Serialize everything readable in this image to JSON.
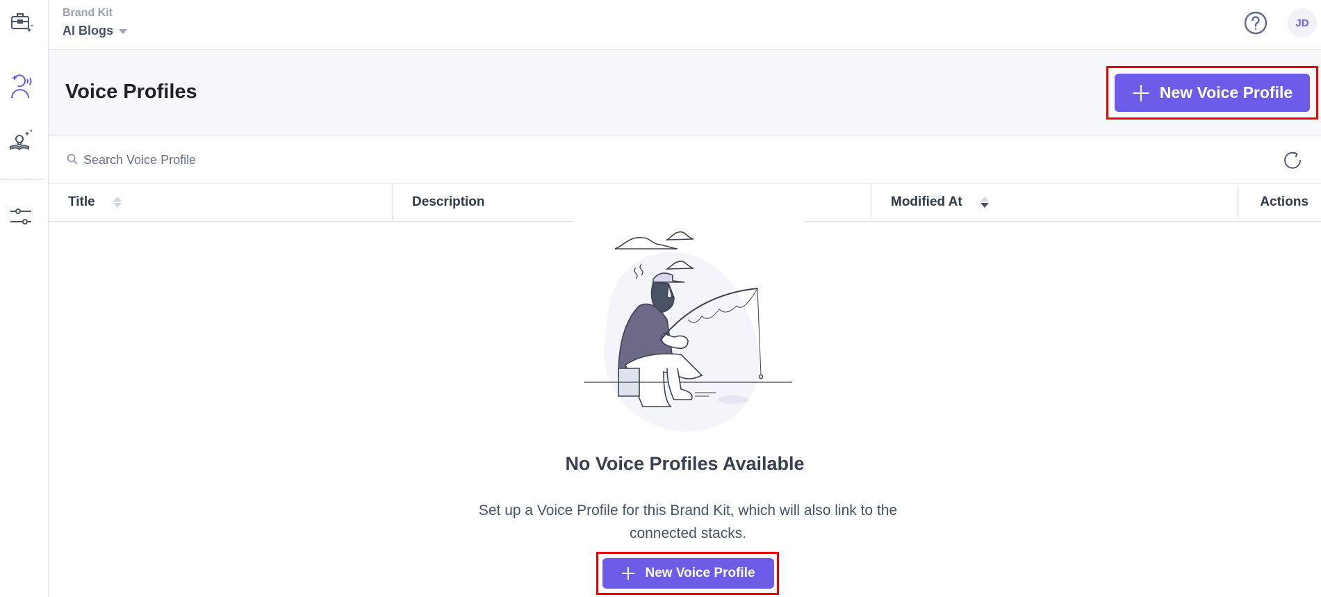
{
  "topbar": {
    "breadcrumb_parent": "Brand Kit",
    "current_kit": "AI Blogs",
    "avatar_initials": "JD"
  },
  "sidebar": {
    "items": [
      {
        "name": "brand-kit",
        "icon": "briefcase-sparkle-icon"
      },
      {
        "name": "voice-profiles",
        "icon": "voice-profile-icon",
        "active": true
      },
      {
        "name": "knowledge-vault",
        "icon": "lightbulb-book-icon"
      },
      {
        "name": "settings",
        "icon": "sliders-icon"
      }
    ]
  },
  "page": {
    "title": "Voice Profiles",
    "new_button_label": "New Voice Profile"
  },
  "search": {
    "placeholder": "Search Voice Profile",
    "value": ""
  },
  "table": {
    "columns": [
      {
        "label": "Title",
        "sortable": true
      },
      {
        "label": "Description",
        "sortable": false
      },
      {
        "label": "Modified At",
        "sortable": true,
        "sort": "desc"
      },
      {
        "label": "Actions",
        "sortable": false
      }
    ],
    "rows": []
  },
  "empty_state": {
    "title": "No Voice Profiles Available",
    "description": "Set up a Voice Profile for this Brand Kit, which will also link to the connected stacks.",
    "button_label": "New Voice Profile",
    "illustration": "man-fishing-illustration"
  },
  "colors": {
    "accent": "#6c5ce7",
    "highlight_box": "#ee0000"
  }
}
